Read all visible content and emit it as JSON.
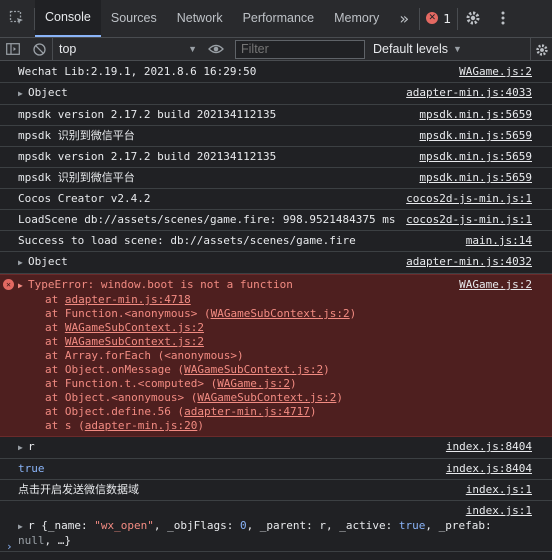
{
  "tabs": [
    {
      "label": "Console",
      "active": true
    },
    {
      "label": "Sources"
    },
    {
      "label": "Network"
    },
    {
      "label": "Performance"
    },
    {
      "label": "Memory"
    }
  ],
  "tabbar": {
    "more": "»",
    "error_count": "1"
  },
  "toolbar": {
    "context": "top",
    "filter_placeholder": "Filter",
    "levels_label": "Default levels"
  },
  "logs": [
    {
      "text": "Wechat Lib:2.19.1, 2021.8.6 16:29:50",
      "src": "WAGame.js:2"
    },
    {
      "text": "Object",
      "src": "adapter-min.js:4033",
      "expandable": true
    },
    {
      "text": "mpsdk version 2.17.2 build 202134112135",
      "src": "mpsdk.min.js:5659"
    },
    {
      "text": "mpsdk 识别到微信平台",
      "src": "mpsdk.min.js:5659"
    },
    {
      "text": "mpsdk version 2.17.2 build 202134112135",
      "src": "mpsdk.min.js:5659"
    },
    {
      "text": "mpsdk 识别到微信平台",
      "src": "mpsdk.min.js:5659"
    },
    {
      "text": "Cocos Creator v2.4.2",
      "src": "cocos2d-js-min.js:1"
    },
    {
      "text": "LoadScene db://assets/scenes/game.fire: 998.9521484375 ms",
      "src": "cocos2d-js-min.js:1"
    },
    {
      "text": "Success to load scene: db://assets/scenes/game.fire",
      "src": "main.js:14"
    },
    {
      "text": "Object",
      "src": "adapter-min.js:4032",
      "expandable": true
    }
  ],
  "error": {
    "message": "TypeError: window.boot is not a function",
    "src": "WAGame.js:2",
    "stack": [
      [
        "at ",
        "adapter-min.js:4718",
        ""
      ],
      [
        "at Function.<anonymous> (",
        "WAGameSubContext.js:2",
        ")"
      ],
      [
        "at ",
        "WAGameSubContext.js:2",
        ""
      ],
      [
        "at ",
        "WAGameSubContext.js:2",
        ""
      ],
      [
        "at Array.forEach (<anonymous>)",
        "",
        ""
      ],
      [
        "at Object.onMessage (",
        "WAGameSubContext.js:2",
        ")"
      ],
      [
        "at Function.t.<computed> (",
        "WAGame.js:2",
        ")"
      ],
      [
        "at Object.<anonymous> (",
        "WAGameSubContext.js:2",
        ")"
      ],
      [
        "at Object.define.56 (",
        "adapter-min.js:4717",
        ")"
      ],
      [
        "at s (",
        "adapter-min.js:20",
        ")"
      ]
    ]
  },
  "after": [
    {
      "text": "r",
      "src": "index.js:8404",
      "expandable": true
    },
    {
      "text": "true",
      "src": "index.js:8404",
      "bool": true
    },
    {
      "text": "点击开启发送微信数据域",
      "src": "index.js:1"
    }
  ],
  "last": {
    "src": "index.js:1",
    "line1_prefix": "r {_name: ",
    "name_val": "\"wx_open\"",
    "mid1": ", _objFlags: ",
    "flags_val": "0",
    "mid2": ", _parent: r, _active: ",
    "active_val": "true",
    "mid3": ", _prefab: ",
    "prefab_val": "null",
    "tail": ", …}"
  },
  "prompt": "›",
  "colors": {
    "accent": "#8ab4f8",
    "error": "#f28b82",
    "error_bg": "#4e1f1f"
  }
}
